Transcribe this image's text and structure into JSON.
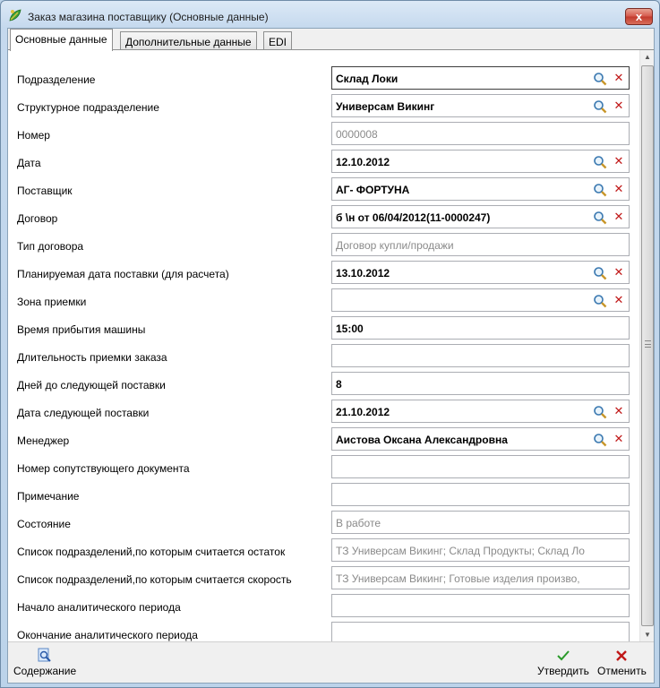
{
  "window": {
    "title": "Заказ магазина поставщику (Основные данные)",
    "close_label": "x"
  },
  "tabs": [
    {
      "label": "Основные данные",
      "active": true
    },
    {
      "label": "Дополнительные данные",
      "active": false
    },
    {
      "label": "EDI",
      "active": false
    }
  ],
  "fields": [
    {
      "label": "Подразделение",
      "value": "Склад Локи",
      "style": "bold",
      "lookup": true
    },
    {
      "label": "Структурное подразделение",
      "value": "Универсам Викинг",
      "style": "bold",
      "lookup": true
    },
    {
      "label": "Номер",
      "value": "0000008",
      "style": "gray",
      "lookup": false
    },
    {
      "label": "Дата",
      "value": "12.10.2012",
      "style": "bold",
      "lookup": true
    },
    {
      "label": "Поставщик",
      "value": "АГ- ФОРТУНА",
      "style": "bold",
      "lookup": true
    },
    {
      "label": "Договор",
      "value": "б \\н от 06/04/2012(11-0000247)",
      "style": "bold",
      "lookup": true
    },
    {
      "label": "Тип договора",
      "value": "Договор купли/продажи",
      "style": "gray",
      "lookup": false
    },
    {
      "label": "Планируемая дата поставки (для расчета)",
      "value": "13.10.2012",
      "style": "bold",
      "lookup": true
    },
    {
      "label": "Зона приемки",
      "value": "",
      "style": "bold",
      "lookup": true
    },
    {
      "label": "Время прибытия машины",
      "value": "15:00",
      "style": "bold",
      "lookup": false
    },
    {
      "label": "Длительность приемки заказа",
      "value": "",
      "style": "bold",
      "lookup": false
    },
    {
      "label": "Дней до следующей поставки",
      "value": "8",
      "style": "bold",
      "lookup": false
    },
    {
      "label": "Дата следующей поставки",
      "value": "21.10.2012",
      "style": "bold",
      "lookup": true
    },
    {
      "label": "Менеджер",
      "value": "Аистова Оксана Александровна",
      "style": "bold",
      "lookup": true
    },
    {
      "label": "Номер сопутствующего документа",
      "value": "",
      "style": "bold",
      "lookup": false
    },
    {
      "label": "Примечание",
      "value": "",
      "style": "bold",
      "lookup": false
    },
    {
      "label": "Состояние",
      "value": "В работе",
      "style": "gray",
      "lookup": false
    },
    {
      "label": "Список подразделений,по которым считается остаток",
      "value": "ТЗ Универсам Викинг; Склад Продукты; Склад Ло",
      "style": "gray",
      "lookup": false
    },
    {
      "label": "Список подразделений,по которым считается скорость",
      "value": "ТЗ Универсам Викинг; Готовые изделия произво,",
      "style": "gray",
      "lookup": false
    },
    {
      "label": "Начало аналитического периода",
      "value": "",
      "style": "bold",
      "lookup": false
    },
    {
      "label": "Окончание аналитического периода",
      "value": "",
      "style": "bold",
      "lookup": false
    }
  ],
  "footer": {
    "contents_label": "Содержание",
    "approve_label": "Утвердить",
    "cancel_label": "Отменить"
  },
  "icons": {
    "app": "app-leaf-icon",
    "lookup": "search-icon",
    "clear": "clear-icon",
    "contents": "contents-icon",
    "approve": "checkmark-icon",
    "cancel": "cancel-icon"
  },
  "colors": {
    "clear_icon": "#c01818",
    "approve_icon": "#2a9a2a",
    "cancel_icon": "#c01818",
    "titlebar": "#c5d9ee"
  }
}
